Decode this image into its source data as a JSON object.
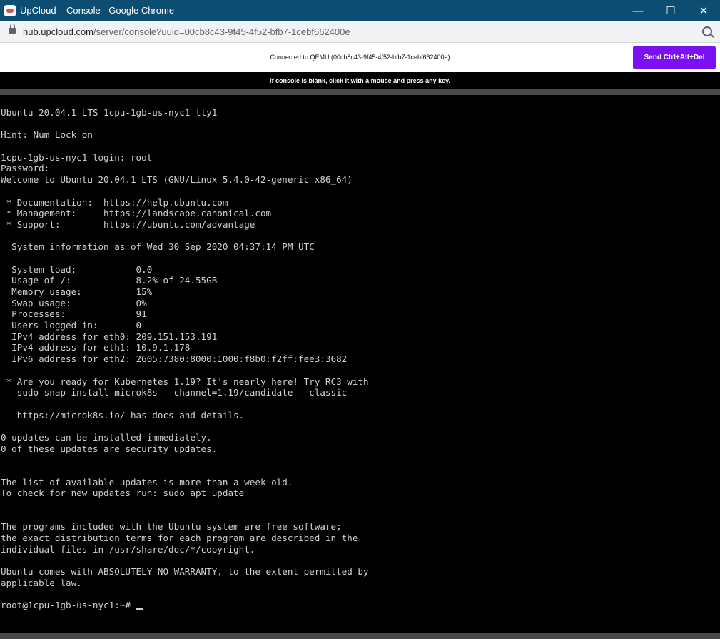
{
  "window": {
    "title": "UpCloud – Console - Google Chrome",
    "minimize": "—",
    "maximize": "☐",
    "close": "✕"
  },
  "address_bar": {
    "url_host": "hub.upcloud.com",
    "url_path": "/server/console?uuid=00cb8c43-9f45-4f52-bfb7-1cebf662400e"
  },
  "console_header": {
    "connected_text": "Connected to QEMU (00cb8c43-9f45-4f52-bfb7-1cebf662400e)",
    "send_button_label": "Send Ctrl+Alt+Del",
    "hint": "If console is blank, click it with a mouse and press any key."
  },
  "terminal": {
    "lines": [
      "Ubuntu 20.04.1 LTS 1cpu-1gb-us-nyc1 tty1",
      "",
      "Hint: Num Lock on",
      "",
      "1cpu-1gb-us-nyc1 login: root",
      "Password:",
      "Welcome to Ubuntu 20.04.1 LTS (GNU/Linux 5.4.0-42-generic x86_64)",
      "",
      " * Documentation:  https://help.ubuntu.com",
      " * Management:     https://landscape.canonical.com",
      " * Support:        https://ubuntu.com/advantage",
      "",
      "  System information as of Wed 30 Sep 2020 04:37:14 PM UTC",
      "",
      "  System load:           0.0",
      "  Usage of /:            8.2% of 24.55GB",
      "  Memory usage:          15%",
      "  Swap usage:            0%",
      "  Processes:             91",
      "  Users logged in:       0",
      "  IPv4 address for eth0: 209.151.153.191",
      "  IPv4 address for eth1: 10.9.1.178",
      "  IPv6 address for eth2: 2605:7380:8000:1000:f8b0:f2ff:fee3:3682",
      "",
      " * Are you ready for Kubernetes 1.19? It's nearly here! Try RC3 with",
      "   sudo snap install microk8s --channel=1.19/candidate --classic",
      "",
      "   https://microk8s.io/ has docs and details.",
      "",
      "0 updates can be installed immediately.",
      "0 of these updates are security updates.",
      "",
      "",
      "The list of available updates is more than a week old.",
      "To check for new updates run: sudo apt update",
      "",
      "",
      "The programs included with the Ubuntu system are free software;",
      "the exact distribution terms for each program are described in the",
      "individual files in /usr/share/doc/*/copyright.",
      "",
      "Ubuntu comes with ABSOLUTELY NO WARRANTY, to the extent permitted by",
      "applicable law.",
      ""
    ],
    "prompt": "root@1cpu-1gb-us-nyc1:~# "
  }
}
